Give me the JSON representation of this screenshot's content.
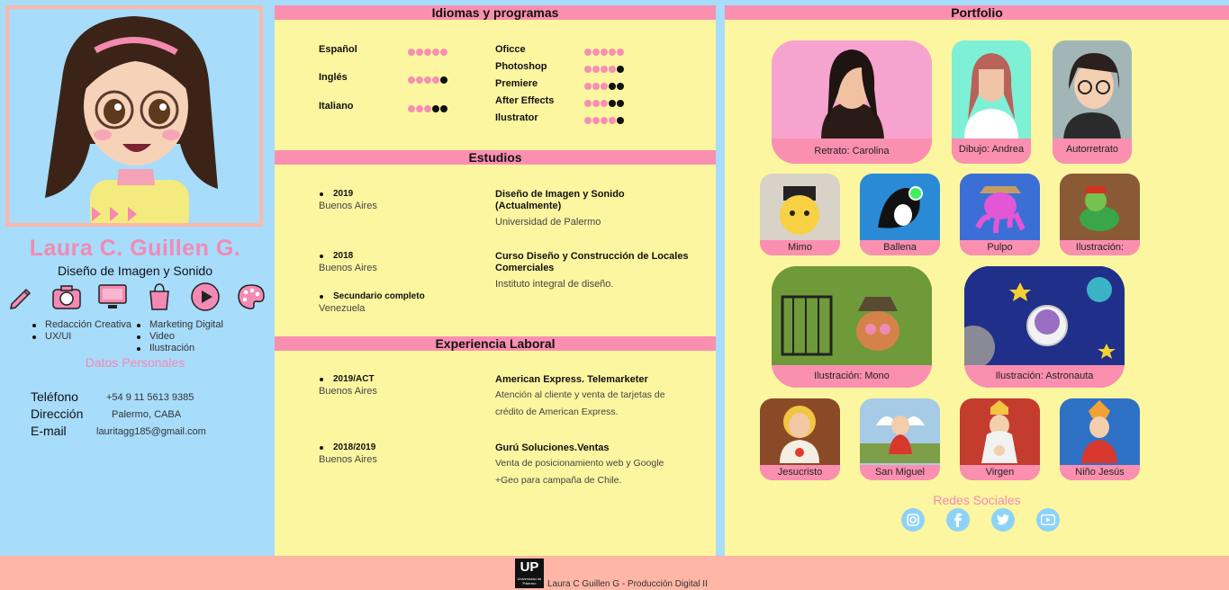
{
  "profile": {
    "name": "Laura C. Guillen G.",
    "role": "Diseño de Imagen y Sonido",
    "icons": [
      "pencil-icon",
      "camera-icon",
      "monitor-icon",
      "shopping-bag-icon",
      "play-icon",
      "palette-icon"
    ],
    "skills_col1": [
      "Redacción Creativa",
      "UX/UI"
    ],
    "skills_col2": [
      "Marketing Digital",
      "Video",
      "Ilustración"
    ],
    "personal_title": "Datos Personales",
    "contact": {
      "phone_label": "Teléfono",
      "phone": "+54 9 11 5613 9385",
      "address_label": "Dirección",
      "address": "Palermo, CABA",
      "email_label": "E-mail",
      "email": "lauritagg185@gmail.com"
    }
  },
  "languages": {
    "title": "Idiomas y programas",
    "langs": [
      {
        "name": "Español",
        "level": 5
      },
      {
        "name": "Inglés",
        "level": 4
      },
      {
        "name": "Italiano",
        "level": 3
      }
    ],
    "programs": [
      {
        "name": "Oficce",
        "level": 5
      },
      {
        "name": "Photoshop",
        "level": 4
      },
      {
        "name": "Premiere",
        "level": 3
      },
      {
        "name": "After Effects",
        "level": 3
      },
      {
        "name": "Ilustrator",
        "level": 4
      }
    ]
  },
  "studies": {
    "title": "Estudios",
    "items": [
      {
        "year": "2019",
        "place": "Buenos Aires",
        "title": "Diseño de Imagen y Sonido (Actualmente)",
        "inst": "Universidad de Palermo"
      },
      {
        "year": "2018",
        "place": "Buenos Aires",
        "title": "Curso Diseño y Construcción de Locales Comerciales",
        "inst": "Instituto integral de diseño."
      },
      {
        "year": "Secundario completo",
        "place": "Venezuela"
      }
    ]
  },
  "experience": {
    "title": "Experiencia Laboral",
    "items": [
      {
        "year": "2019/ACT",
        "place": "Buenos Aires",
        "title": "American Express. Telemarketer",
        "desc": "Atención al cliente y venta de tarjetas de crédito de American Express."
      },
      {
        "year": "2018/2019",
        "place": "Buenos Aires",
        "title": "Gurú Soluciones.Ventas",
        "desc": "Venta de posicionamiento web y Google +Geo para campaña de Chile."
      }
    ]
  },
  "portfolio": {
    "title": "Portfolio",
    "cards": [
      "Retrato: Carolina",
      "Dibujo: Andrea",
      "Autorretrato",
      "Mimo",
      "Ballena",
      "Pulpo",
      "Ilustración:",
      "Ilustración: Mono",
      "Ilustración: Astronauta",
      "Jesucristo",
      "San Miguel",
      "Virgen",
      "Niño Jesús"
    ],
    "social_title": "Redes Sociales",
    "social": [
      "instagram-icon",
      "facebook-icon",
      "twitter-icon",
      "youtube-icon"
    ]
  },
  "footer": {
    "logo_text": "UP",
    "logo_sub": "Universidad de Palermo",
    "text": "Laura C Guillen G - Producción Digital II"
  },
  "colors": {
    "sky": "#a7dcfb",
    "pink": "#fb8fb0",
    "yellow": "#fdf6a0",
    "peach": "#ffb6a6",
    "name_pink": "#f38ab4"
  }
}
